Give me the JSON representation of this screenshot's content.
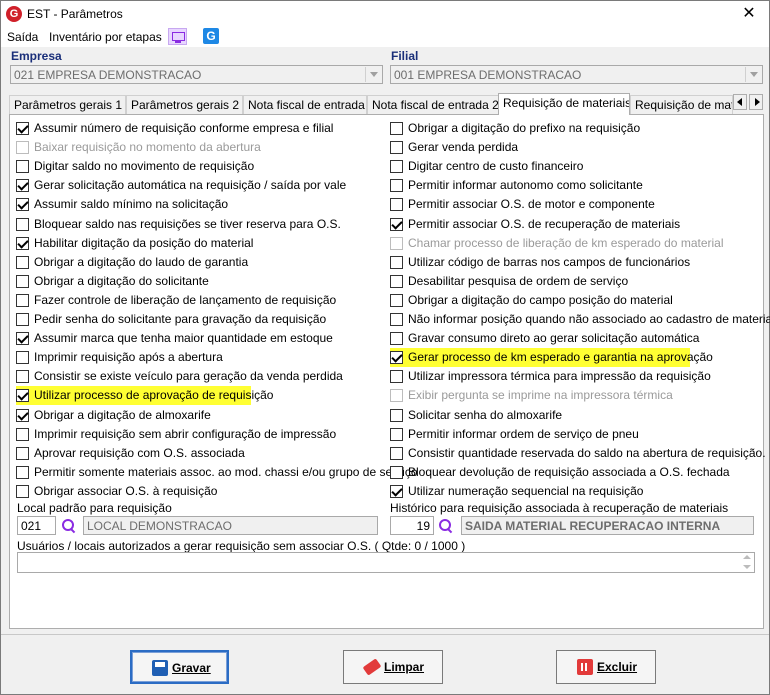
{
  "window": {
    "title": "EST - Parâmetros",
    "close_glyph": "✕",
    "logo_letter": "G",
    "logo_icon": "app-logo-icon"
  },
  "menu": {
    "items": [
      "Saída",
      "Inventário por etapas"
    ],
    "monitor_icon": "monitor-icon",
    "g_icon_letter": "G"
  },
  "empresa": {
    "label": "Empresa",
    "value": "021 EMPRESA DEMONSTRACAO"
  },
  "filial": {
    "label": "Filial",
    "value": "001 EMPRESA DEMONSTRACAO"
  },
  "tabs": [
    {
      "label": "Parâmetros gerais 1",
      "active": false
    },
    {
      "label": "Parâmetros gerais 2",
      "active": false
    },
    {
      "label": "Nota fiscal de entrada",
      "active": false
    },
    {
      "label": "Nota fiscal de entrada 2",
      "active": false
    },
    {
      "label": "Requisição de materiais",
      "active": true
    },
    {
      "label": "Requisição de materiais",
      "active": false
    }
  ],
  "left_options": [
    {
      "label": "Assumir número de requisição conforme empresa e filial",
      "checked": true,
      "disabled": false,
      "highlight": false
    },
    {
      "label": "Baixar requisição no momento da abertura",
      "checked": false,
      "disabled": true,
      "highlight": false
    },
    {
      "label": "Digitar saldo no movimento de requisição",
      "checked": false,
      "disabled": false,
      "highlight": false
    },
    {
      "label": "Gerar solicitação automática na requisição / saída por vale",
      "checked": true,
      "disabled": false,
      "highlight": false
    },
    {
      "label": "Assumir saldo mínimo na solicitação",
      "checked": true,
      "disabled": false,
      "highlight": false
    },
    {
      "label": "Bloquear saldo nas requisições se tiver reserva para O.S.",
      "checked": false,
      "disabled": false,
      "highlight": false
    },
    {
      "label": "Habilitar digitação da posição do material",
      "checked": true,
      "disabled": false,
      "highlight": false
    },
    {
      "label": "Obrigar a digitação do laudo de garantia",
      "checked": false,
      "disabled": false,
      "highlight": false
    },
    {
      "label": "Obrigar a digitação do solicitante",
      "checked": false,
      "disabled": false,
      "highlight": false
    },
    {
      "label": "Fazer controle de liberação de lançamento de requisição",
      "checked": false,
      "disabled": false,
      "highlight": false
    },
    {
      "label": "Pedir senha do solicitante para gravação da requisição",
      "checked": false,
      "disabled": false,
      "highlight": false
    },
    {
      "label": "Assumir marca que tenha maior quantidade em estoque",
      "checked": true,
      "disabled": false,
      "highlight": false
    },
    {
      "label": "Imprimir requisição após a abertura",
      "checked": false,
      "disabled": false,
      "highlight": false
    },
    {
      "label": "Consistir se existe veículo para geração da venda perdida",
      "checked": false,
      "disabled": false,
      "highlight": false
    },
    {
      "label": "Utilizar processo de aprovação de requisição",
      "checked": true,
      "disabled": false,
      "highlight": true
    },
    {
      "label": "Obrigar a digitação de almoxarife",
      "checked": true,
      "disabled": false,
      "highlight": false
    },
    {
      "label": "Imprimir requisição sem abrir configuração de impressão",
      "checked": false,
      "disabled": false,
      "highlight": false
    },
    {
      "label": "Aprovar requisição com O.S. associada",
      "checked": false,
      "disabled": false,
      "highlight": false
    },
    {
      "label": "Permitir somente materiais assoc. ao mod. chassi e/ou grupo de serviço",
      "checked": false,
      "disabled": false,
      "highlight": false
    },
    {
      "label": "Obrigar associar O.S. à requisição",
      "checked": false,
      "disabled": false,
      "highlight": false
    }
  ],
  "right_options": [
    {
      "label": "Obrigar a digitação do prefixo na requisição",
      "checked": false,
      "disabled": false,
      "highlight": false
    },
    {
      "label": "Gerar venda perdida",
      "checked": false,
      "disabled": false,
      "highlight": false
    },
    {
      "label": "Digitar centro de custo financeiro",
      "checked": false,
      "disabled": false,
      "highlight": false
    },
    {
      "label": "Permitir informar autonomo como solicitante",
      "checked": false,
      "disabled": false,
      "highlight": false
    },
    {
      "label": "Permitir associar O.S. de motor e componente",
      "checked": false,
      "disabled": false,
      "highlight": false
    },
    {
      "label": "Permitir associar O.S. de recuperação de materiais",
      "checked": true,
      "disabled": false,
      "highlight": false
    },
    {
      "label": "Chamar processo de liberação de km esperado do material",
      "checked": false,
      "disabled": true,
      "highlight": false
    },
    {
      "label": "Utilizar código de barras nos campos de funcionários",
      "checked": false,
      "disabled": false,
      "highlight": false
    },
    {
      "label": "Desabilitar pesquisa de ordem de serviço",
      "checked": false,
      "disabled": false,
      "highlight": false
    },
    {
      "label": "Obrigar a digitação do campo posição do material",
      "checked": false,
      "disabled": false,
      "highlight": false
    },
    {
      "label": "Não informar posição quando não associado ao cadastro de material",
      "checked": false,
      "disabled": false,
      "highlight": false
    },
    {
      "label": "Gravar consumo direto ao gerar solicitação automática",
      "checked": false,
      "disabled": false,
      "highlight": false
    },
    {
      "label": "Gerar processo de km esperado e garantia na aprovação",
      "checked": true,
      "disabled": false,
      "highlight": true
    },
    {
      "label": "Utilizar impressora térmica para impressão da requisição",
      "checked": false,
      "disabled": false,
      "highlight": false
    },
    {
      "label": "Exibir pergunta se imprime na impressora térmica",
      "checked": false,
      "disabled": true,
      "highlight": false
    },
    {
      "label": "Solicitar senha do almoxarife",
      "checked": false,
      "disabled": false,
      "highlight": false
    },
    {
      "label": "Permitir informar ordem de serviço de pneu",
      "checked": false,
      "disabled": false,
      "highlight": false
    },
    {
      "label": "Consistir quantidade reservada do saldo na abertura de requisição.",
      "checked": false,
      "disabled": false,
      "highlight": false
    },
    {
      "label": "Bloquear devolução de requisição associada a O.S. fechada",
      "checked": false,
      "disabled": false,
      "highlight": false
    },
    {
      "label": "Utilizar numeração sequencial na requisição",
      "checked": true,
      "disabled": false,
      "highlight": false
    }
  ],
  "local": {
    "label": "Local padrão para requisição",
    "code": "021",
    "description": "LOCAL DEMONSTRACAO"
  },
  "historico": {
    "label": "Histórico para requisição associada à recuperação de materiais",
    "code": "19",
    "description": "SAIDA MATERIAL RECUPERACAO INTERNA"
  },
  "usuarios": {
    "label": "Usuários / locais autorizados a gerar requisição sem associar O.S.   ( Qtde: 0 / 1000 )",
    "value": ""
  },
  "buttons": {
    "save": "Gravar",
    "clear": "Limpar",
    "delete": "Excluir"
  }
}
